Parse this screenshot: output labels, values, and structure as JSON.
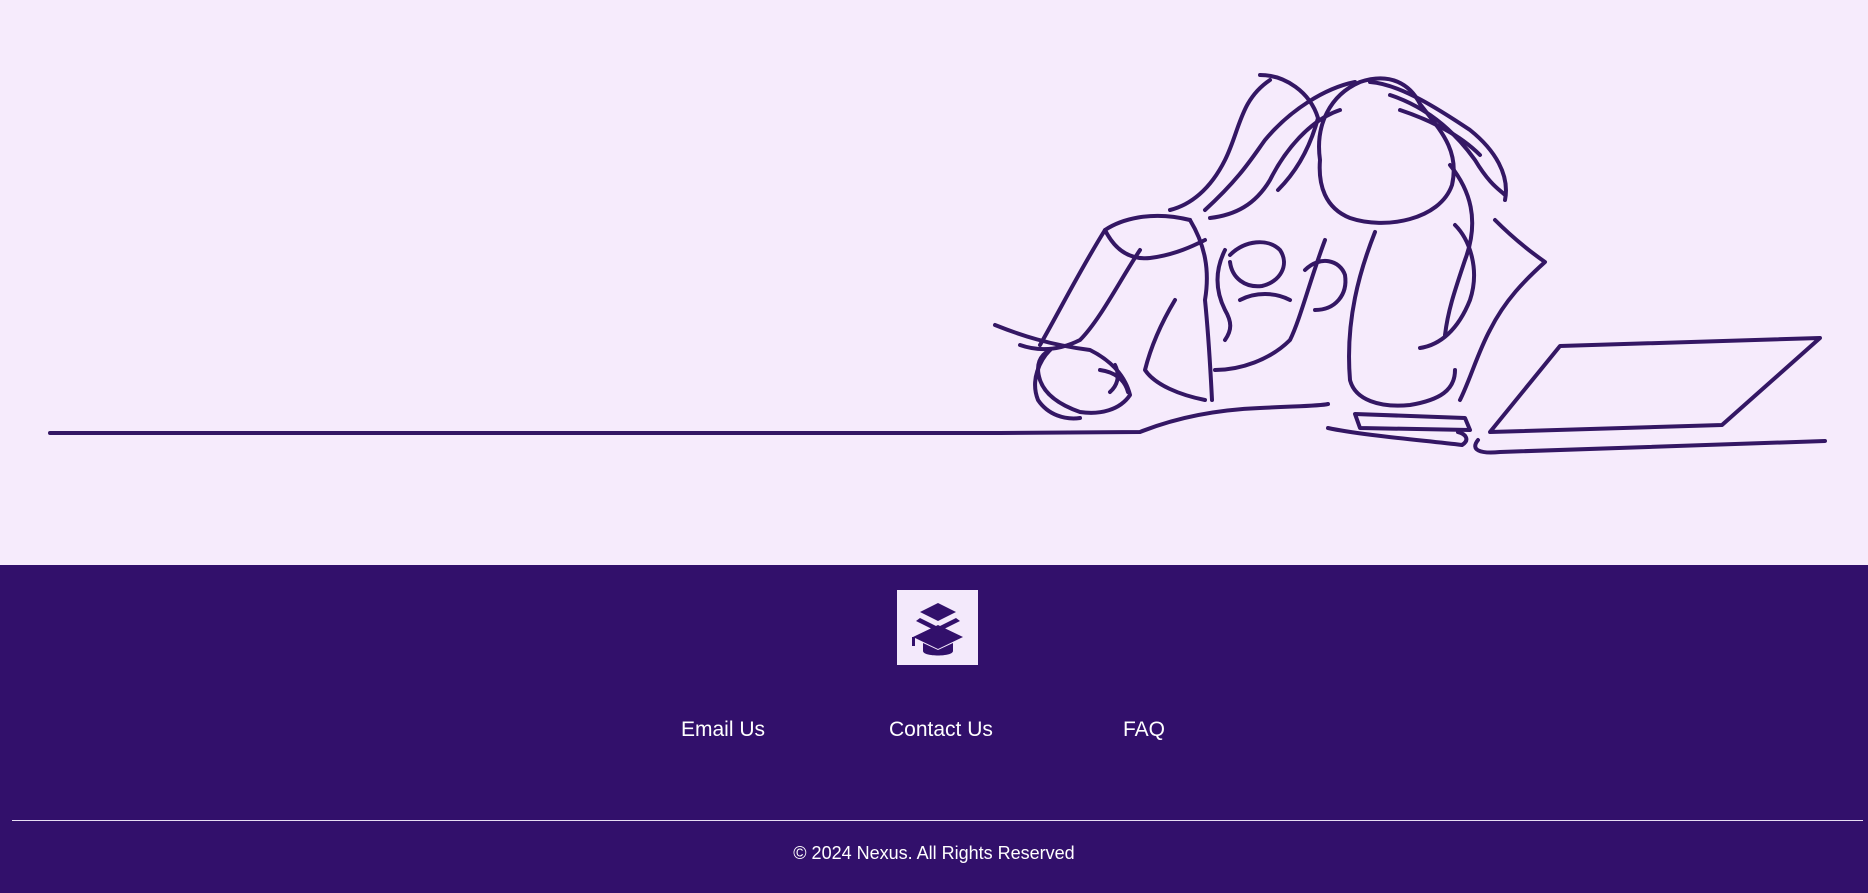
{
  "colors": {
    "hero_background": "#F6EBFC",
    "footer_background": "#32106B",
    "line_art": "#341764",
    "logo_background": "#F3E9FB",
    "text": "#FFFFFF"
  },
  "hero": {
    "illustration_icon": "woman-studying-at-laptop-line-art"
  },
  "footer": {
    "logo_icon": "graduation-cap-book-stack-icon",
    "links": {
      "email": "Email Us",
      "contact": "Contact Us",
      "faq": "FAQ"
    },
    "copyright": "© 2024 Nexus. All Rights Reserved"
  }
}
